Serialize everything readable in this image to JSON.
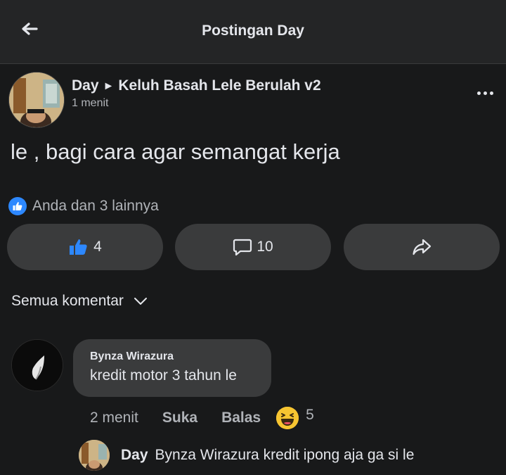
{
  "header": {
    "title": "Postingan Day",
    "back_icon": "back-arrow-icon"
  },
  "post": {
    "author": "Day",
    "group": "Keluh Basah Lele Berulah v2",
    "time": "1 menit",
    "text": "le , bagi cara agar semangat kerja",
    "reactions_summary": "Anda dan 3 lainnya",
    "like_count": "4",
    "comment_count": "10"
  },
  "comments_filter": "Semua komentar",
  "comment": {
    "author": "Bynza Wirazura",
    "text": "kredit motor 3 tahun le",
    "time": "2 menit",
    "like_label": "Suka",
    "reply_label": "Balas",
    "reaction_count": "5"
  },
  "reply": {
    "author": "Day",
    "text": "Bynza Wirazura kredit ipong aja ga si le"
  },
  "colors": {
    "background": "#18191a",
    "surface": "#3a3b3c",
    "accent": "#2d88ff",
    "secondary_text": "#b0b3b8"
  }
}
